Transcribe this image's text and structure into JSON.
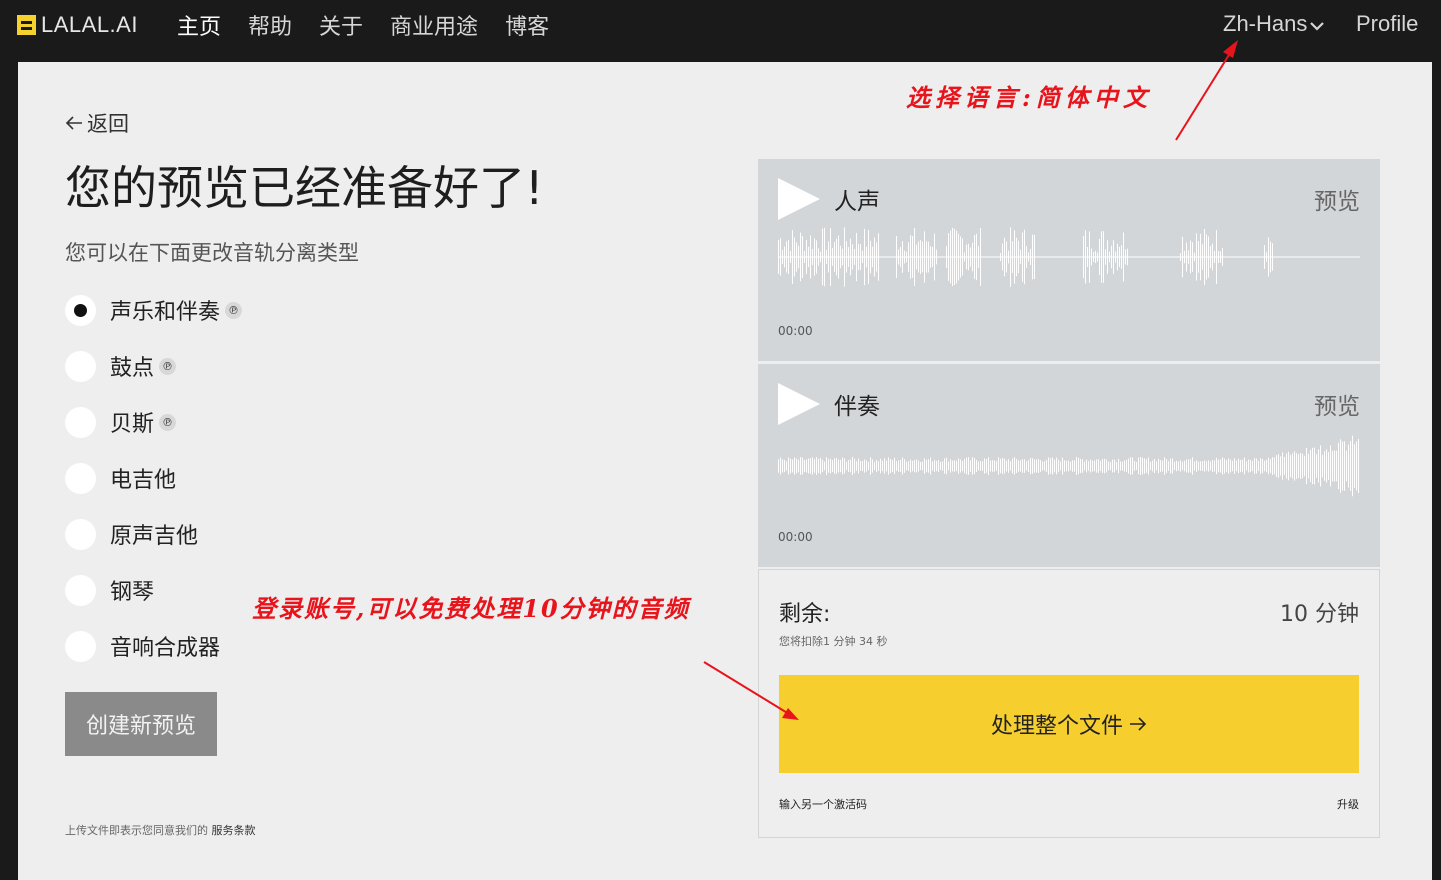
{
  "brand": {
    "name": "LALAL.AI",
    "accent": "#f6cf2f"
  },
  "nav": {
    "items": [
      {
        "label": "主页"
      },
      {
        "label": "帮助"
      },
      {
        "label": "关于"
      },
      {
        "label": "商业用途"
      },
      {
        "label": "博客"
      }
    ],
    "language": "Zh-Hans",
    "profile": "Profile"
  },
  "page": {
    "back": "返回",
    "title": "您的预览已经准备好了!",
    "subtitle": "您可以在下面更改音轨分离类型",
    "options": [
      {
        "label": "声乐和伴奏",
        "pro": true,
        "checked": true
      },
      {
        "label": "鼓点",
        "pro": true,
        "checked": false
      },
      {
        "label": "贝斯",
        "pro": true,
        "checked": false
      },
      {
        "label": "电吉他",
        "pro": false,
        "checked": false
      },
      {
        "label": "原声吉他",
        "pro": false,
        "checked": false
      },
      {
        "label": "钢琴",
        "pro": false,
        "checked": false
      },
      {
        "label": "音响合成器",
        "pro": false,
        "checked": false
      }
    ],
    "pro_badge": "℗",
    "create_button": "创建新预览",
    "terms_text": "上传文件即表示您同意我们的",
    "terms_link": "服务条款"
  },
  "tracks": [
    {
      "name": "人声",
      "preview": "预览",
      "time": "00:00",
      "icon": "play-icon"
    },
    {
      "name": "伴奏",
      "preview": "预览",
      "time": "00:00",
      "icon": "play-icon"
    }
  ],
  "panel": {
    "remaining_label": "剩余:",
    "remaining_value": "10 分钟",
    "deduct_note": "您将扣除1 分钟 34 秒",
    "process_button": "处理整个文件",
    "activation_link": "输入另一个激活码",
    "upgrade_link": "升级"
  },
  "annotations": {
    "language_note": "选择语言:简体中文",
    "login_note": "登录账号,可以免费处理10分钟的音频",
    "color": "#e8141c"
  }
}
